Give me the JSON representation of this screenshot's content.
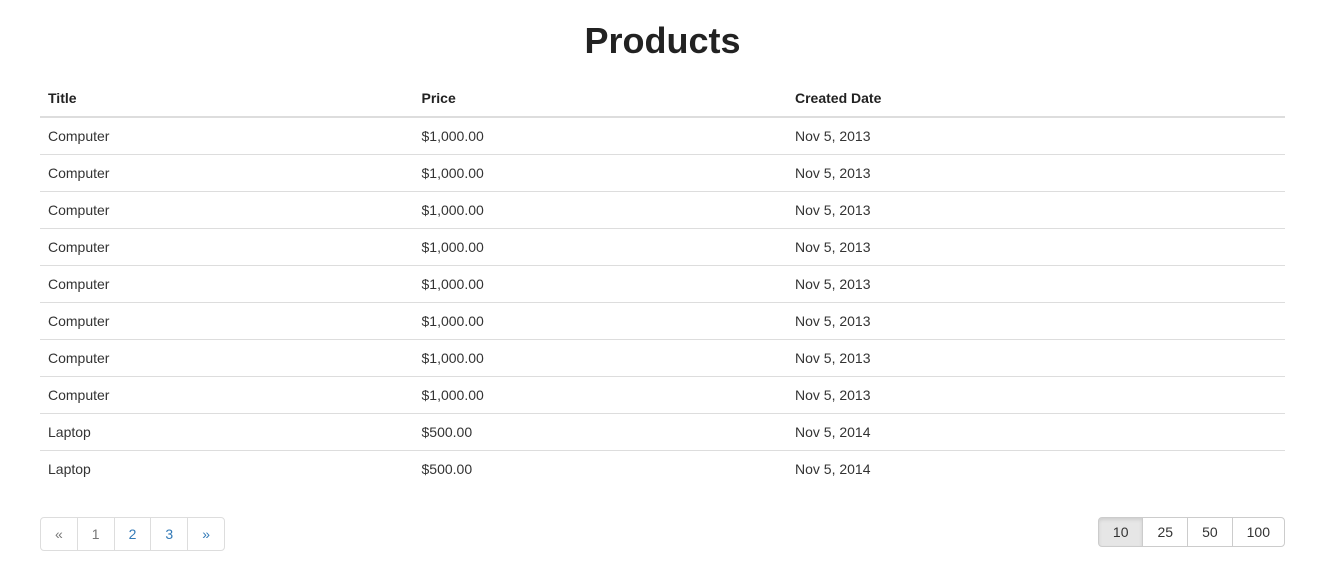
{
  "heading": "Products",
  "columns": {
    "title": "Title",
    "price": "Price",
    "created": "Created Date"
  },
  "rows": [
    {
      "title": "Computer",
      "price": "$1,000.00",
      "created": "Nov 5, 2013"
    },
    {
      "title": "Computer",
      "price": "$1,000.00",
      "created": "Nov 5, 2013"
    },
    {
      "title": "Computer",
      "price": "$1,000.00",
      "created": "Nov 5, 2013"
    },
    {
      "title": "Computer",
      "price": "$1,000.00",
      "created": "Nov 5, 2013"
    },
    {
      "title": "Computer",
      "price": "$1,000.00",
      "created": "Nov 5, 2013"
    },
    {
      "title": "Computer",
      "price": "$1,000.00",
      "created": "Nov 5, 2013"
    },
    {
      "title": "Computer",
      "price": "$1,000.00",
      "created": "Nov 5, 2013"
    },
    {
      "title": "Computer",
      "price": "$1,000.00",
      "created": "Nov 5, 2013"
    },
    {
      "title": "Laptop",
      "price": "$500.00",
      "created": "Nov 5, 2014"
    },
    {
      "title": "Laptop",
      "price": "$500.00",
      "created": "Nov 5, 2014"
    }
  ],
  "pagination": {
    "prev": "«",
    "next": "»",
    "pages": [
      "1",
      "2",
      "3"
    ],
    "current": "1"
  },
  "page_size": {
    "options": [
      "10",
      "25",
      "50",
      "100"
    ],
    "current": "10"
  }
}
